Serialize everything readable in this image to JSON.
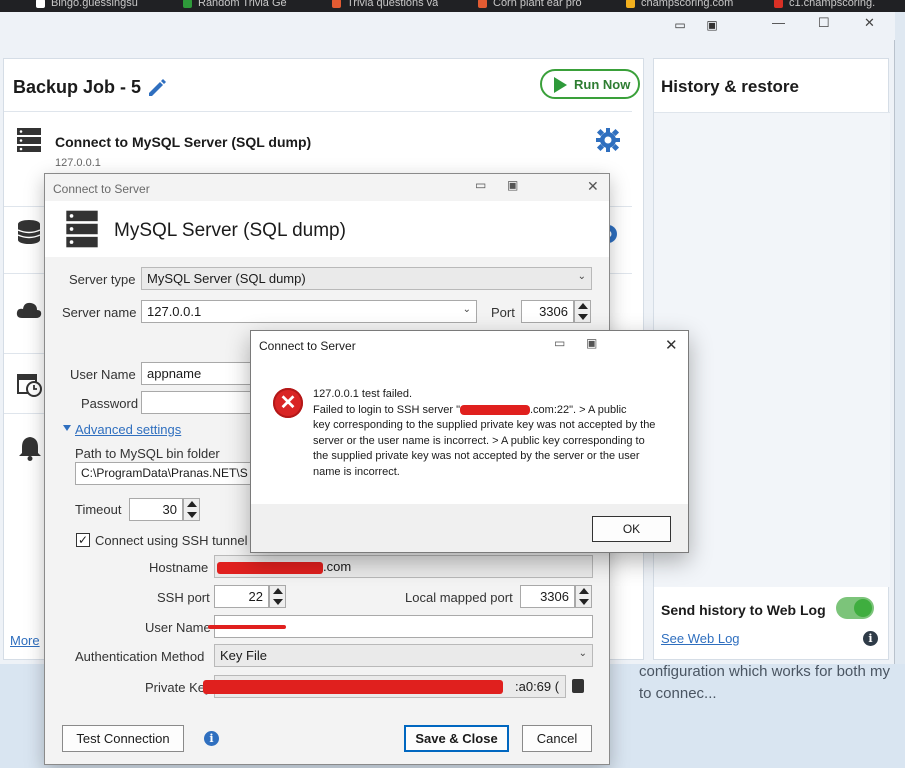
{
  "browser_tabs": [
    {
      "label": "Bingo.guessingsu",
      "color": "#ffffff"
    },
    {
      "label": "Random Trivia Ge",
      "color": "#2e9a3a"
    },
    {
      "label": "Trivia questions va",
      "color": "#e25b32"
    },
    {
      "label": "Corn plant ear pro",
      "color": "#e25b32"
    },
    {
      "label": "champscoring.com",
      "color": "#f2b01e"
    },
    {
      "label": "c1.champscoring.",
      "color": "#d93025"
    }
  ],
  "app": {
    "job_title": "Backup Job - 5",
    "run_now": "Run Now",
    "source_name": "Connect to MySQL Server (SQL dump)",
    "source_sub": "127.0.0.1",
    "more_link": "More",
    "history_title": "History & restore",
    "send_history": "Send history to Web Log",
    "see_web_log": "See Web Log"
  },
  "bg_text": "configuration which works for both my",
  "bg_text2": "to connec...",
  "dialog": {
    "title": "Connect to Server",
    "header": "MySQL Server (SQL dump)",
    "server_type_label": "Server type",
    "server_type_value": "MySQL Server (SQL dump)",
    "server_name_label": "Server name",
    "server_name_value": "127.0.0.1",
    "port_label": "Port",
    "port_value": "3306",
    "username_label": "User Name",
    "username_value": "appname",
    "password_label": "Password",
    "advanced": "Advanced settings",
    "bin_folder_label": "Path to MySQL bin folder",
    "bin_folder_value": "C:\\ProgramData\\Pranas.NET\\S",
    "timeout_label": "Timeout",
    "timeout_value": "30",
    "ssh_checkbox": "Connect using SSH tunnel",
    "hostname_label": "Hostname",
    "hostname_value": ".com",
    "ssh_port_label": "SSH port",
    "ssh_port_value": "22",
    "local_port_label": "Local mapped port",
    "local_port_value": "3306",
    "ssh_user_label": "User Name",
    "auth_label": "Authentication Method",
    "auth_value": "Key File",
    "private_key_label": "Private Key",
    "private_key_value": ":a0:69 (",
    "test_button": "Test Connection",
    "save_button": "Save & Close",
    "cancel_button": "Cancel"
  },
  "error": {
    "title": "Connect to Server",
    "line1": "127.0.0.1 test failed.",
    "line2": "Failed to login to SSH server \"",
    "line2_tail": ".com:22\". > A public",
    "body": "key corresponding to the supplied private key was not accepted by the server or the user name is incorrect. > A public key corresponding to the supplied private key was not accepted by the server or the user name is incorrect.",
    "ok": "OK"
  },
  "colors": {
    "accent": "#2f6fbf",
    "run_green": "#2e9a3a",
    "error_red": "#d92424",
    "redaction": "#e0201e"
  }
}
